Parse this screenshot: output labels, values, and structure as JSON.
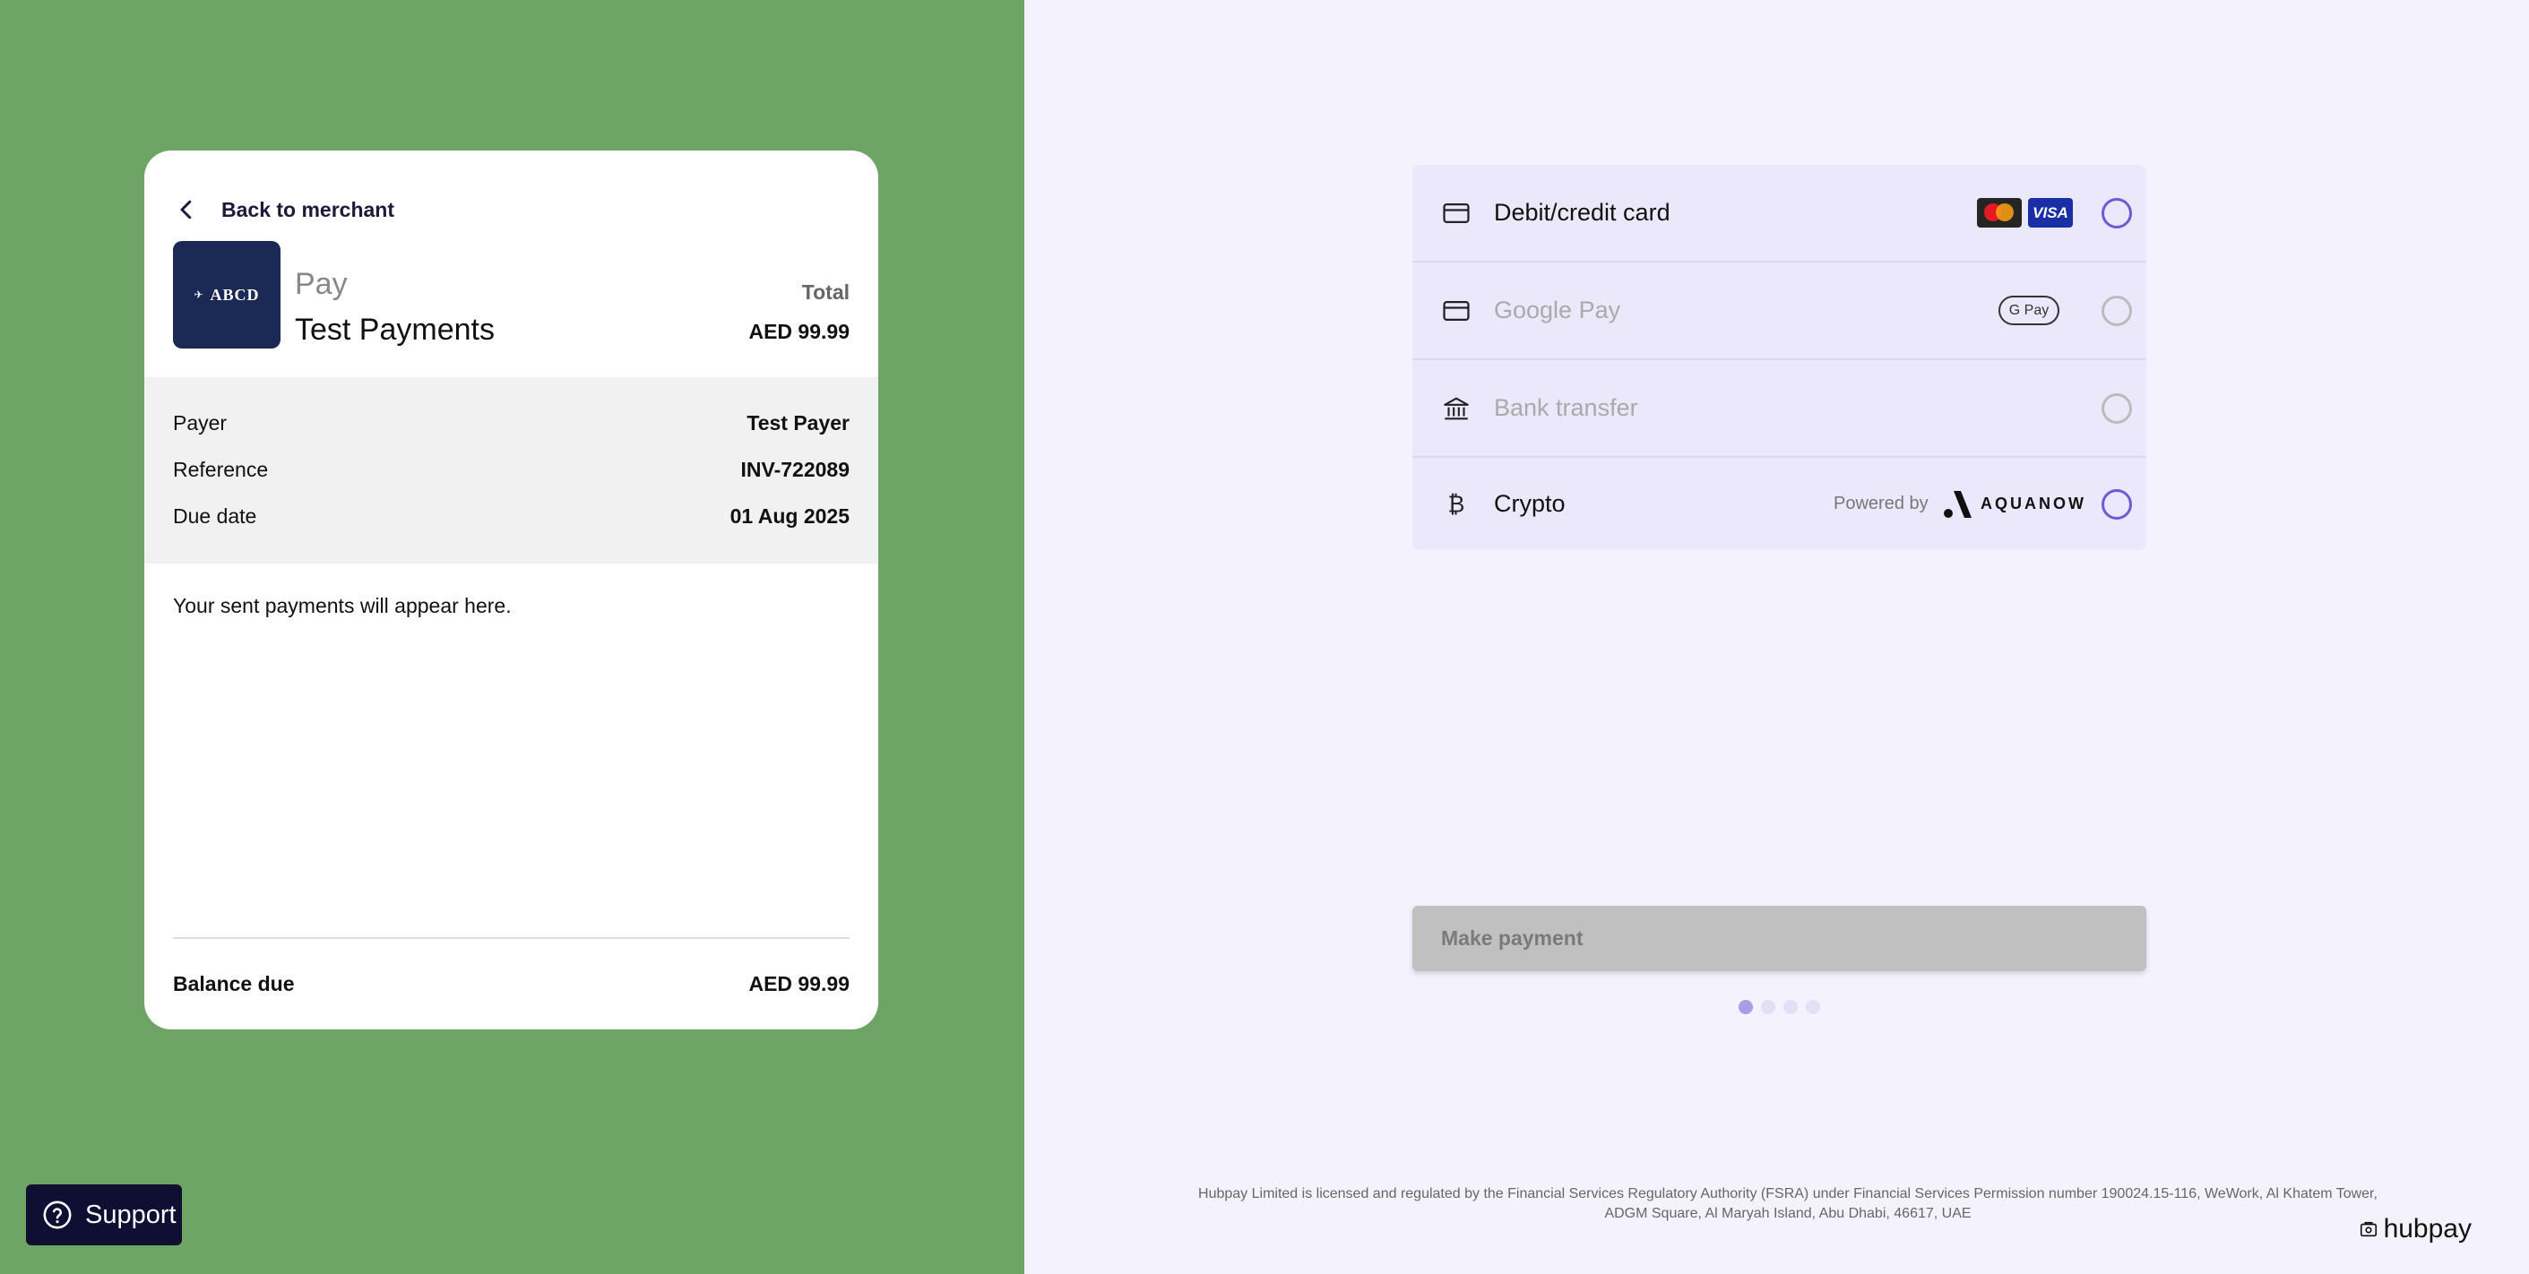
{
  "colors": {
    "left_panel_bg": "#6da564",
    "right_panel_bg": "#f4f3fd",
    "accent_radio": "#6b5bd6",
    "support_bg": "#0f0f33",
    "logo_bg": "#1b2a55"
  },
  "invoice": {
    "back_label": "Back to merchant",
    "logo_text": "ABCD",
    "pay_label": "Pay",
    "merchant_name": "Test Payments",
    "total_label": "Total",
    "total_value": "AED 99.99",
    "details": [
      {
        "label": "Payer",
        "value": "Test Payer"
      },
      {
        "label": "Reference",
        "value": "INV-722089"
      },
      {
        "label": "Due date",
        "value": "01 Aug 2025"
      }
    ],
    "sent_payments_message": "Your sent payments will appear here.",
    "balance_label": "Balance due",
    "balance_value": "AED 99.99"
  },
  "support": {
    "label": "Support",
    "icon": "question-circle-icon"
  },
  "payment_methods": [
    {
      "label": "Debit/credit card",
      "icon": "credit-card-icon",
      "enabled": true,
      "badges": [
        "mastercard-logo",
        "visa-logo"
      ],
      "visa_text": "VISA",
      "selected": false
    },
    {
      "label": "Google Pay",
      "icon": "credit-card-icon",
      "enabled": false,
      "badges": [
        "google-pay-logo"
      ],
      "gpay_text": "G Pay",
      "selected": false
    },
    {
      "label": "Bank transfer",
      "icon": "bank-icon",
      "enabled": false,
      "badges": [],
      "selected": false
    },
    {
      "label": "Crypto",
      "icon": "bitcoin-icon",
      "enabled": true,
      "powered_by": "Powered by",
      "provider": "AQUANOW",
      "selected": false
    }
  ],
  "make_payment_label": "Make payment",
  "progress": {
    "steps": 4,
    "current": 1
  },
  "footer": {
    "legal_line1": "Hubpay Limited is licensed and regulated by the Financial Services Regulatory Authority (FSRA) under Financial Services Permission number 190024.15-116, WeWork, Al Khatem Tower,",
    "legal_line2": "ADGM Square, Al Maryah Island, Abu Dhabi, 46617, UAE",
    "brand": "hubpay"
  }
}
